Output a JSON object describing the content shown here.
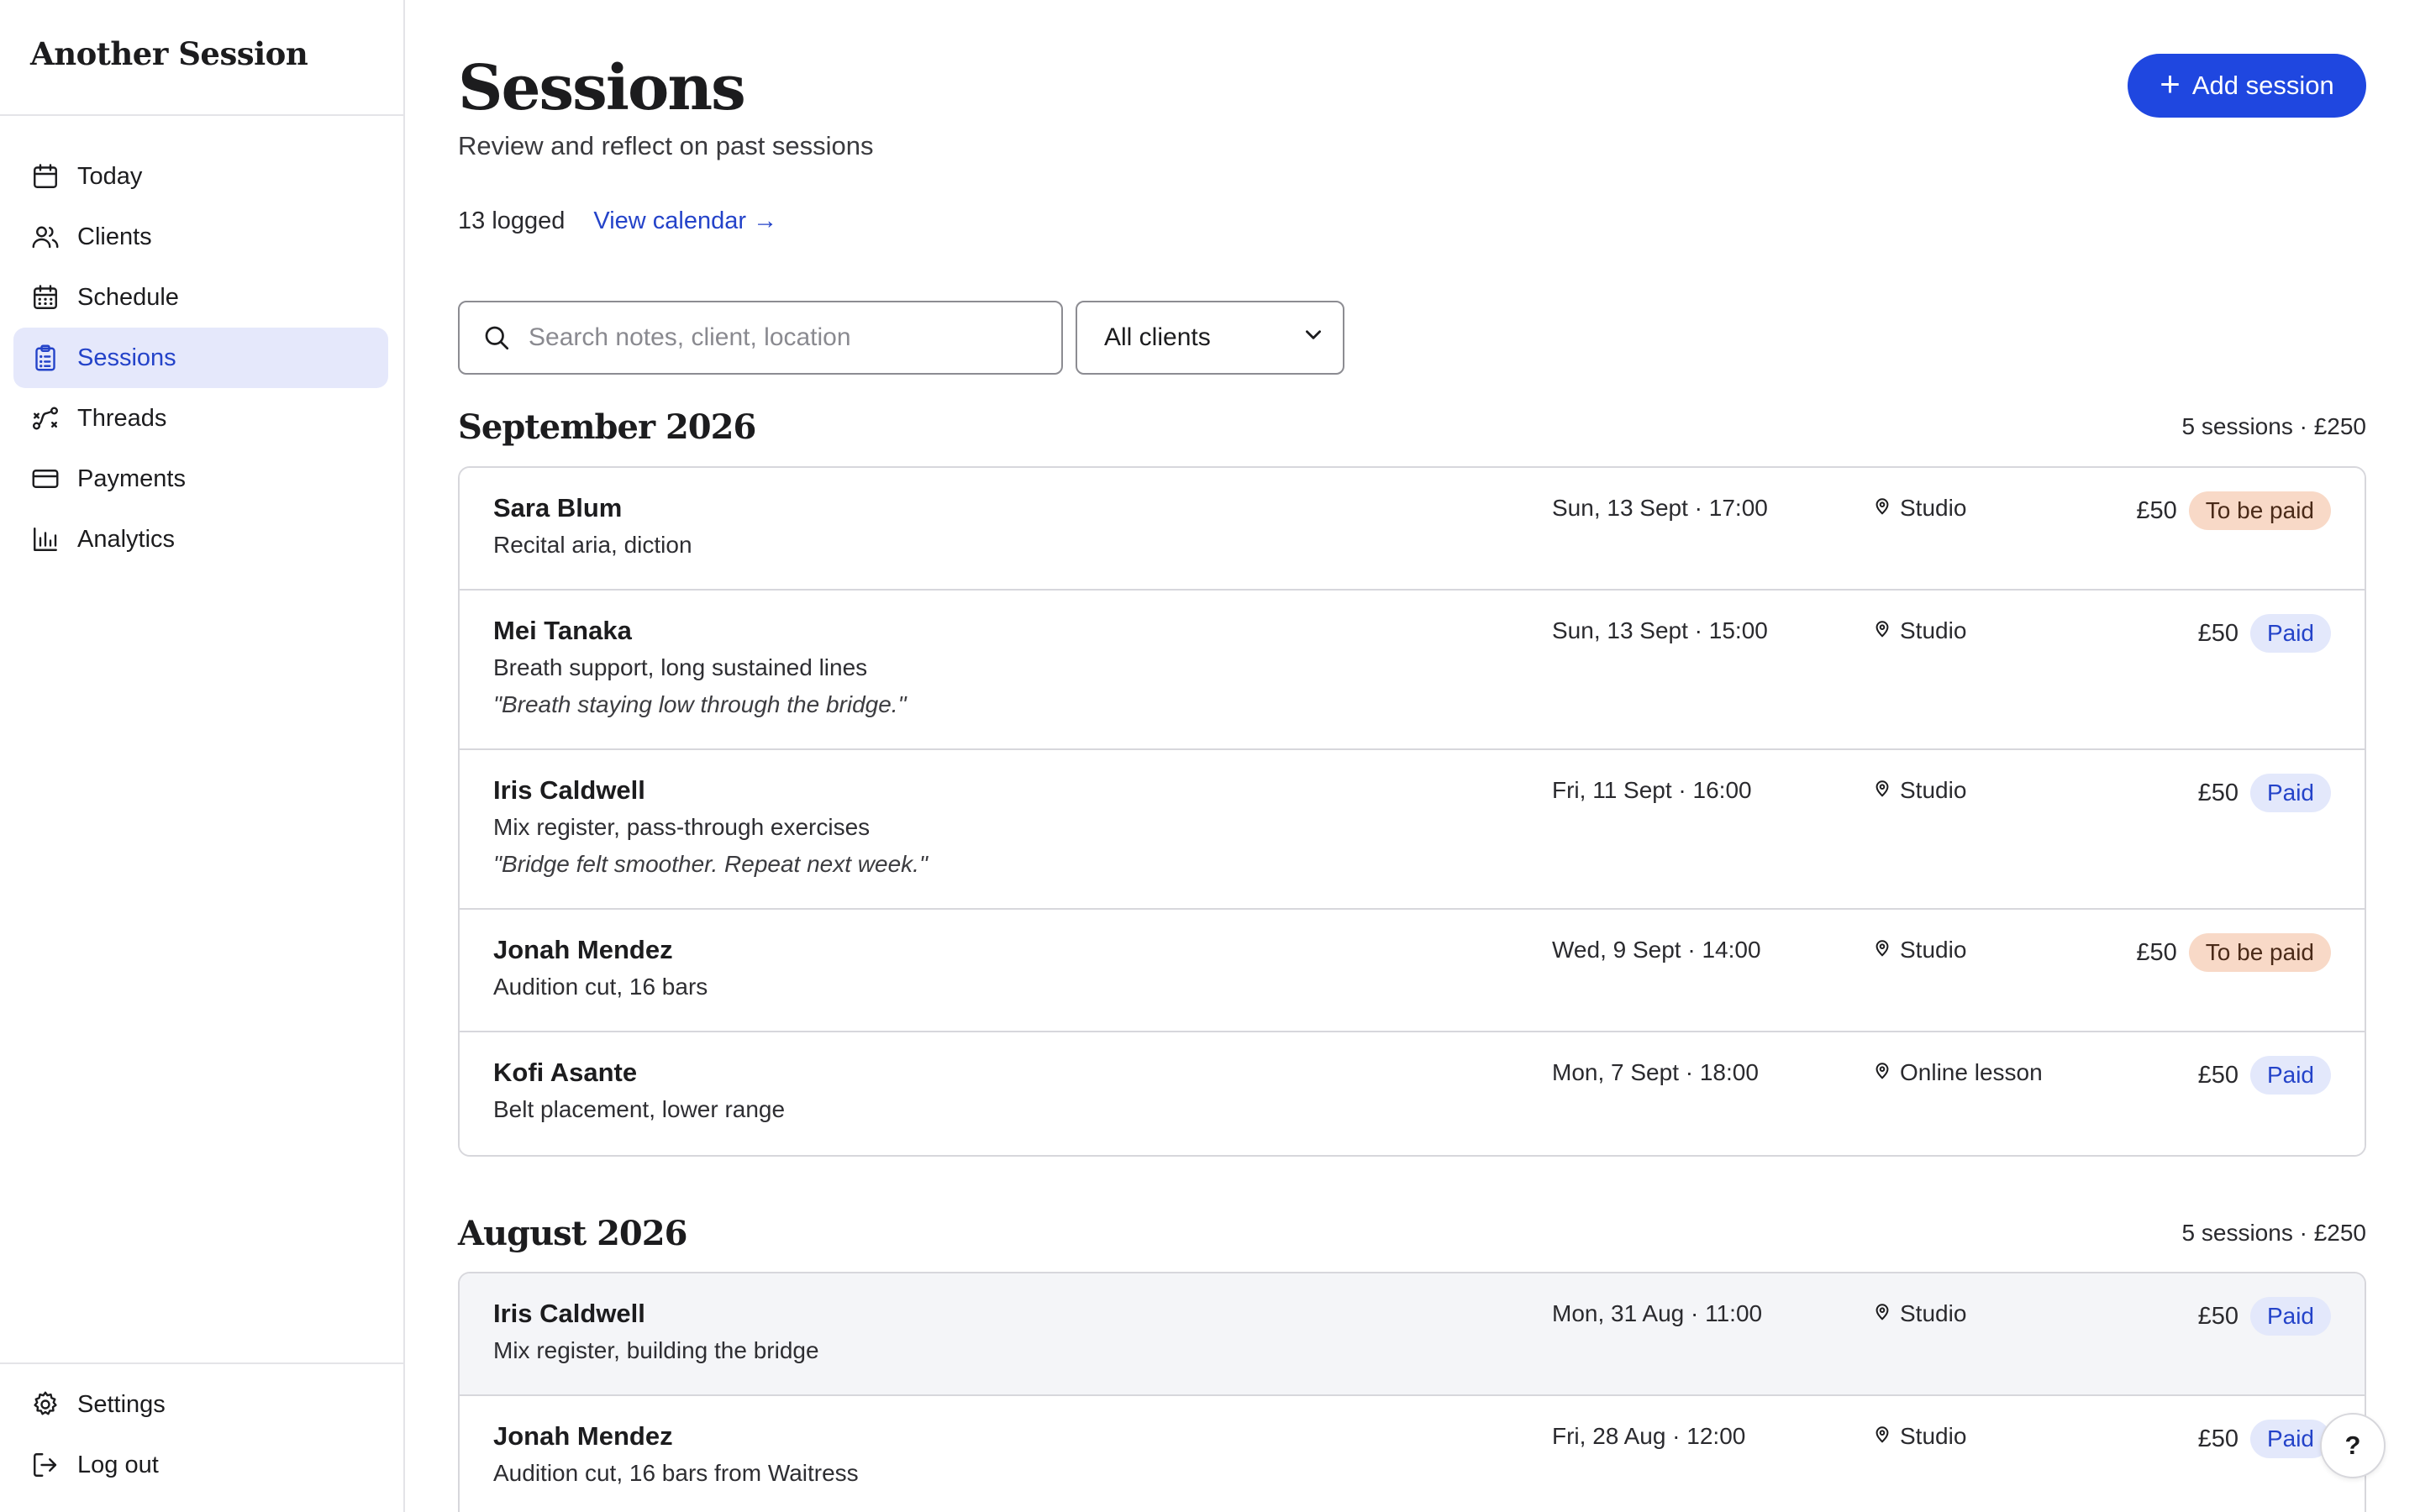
{
  "app": {
    "brand": "Another Session"
  },
  "sidebar": {
    "items": [
      {
        "label": "Today",
        "icon": "calendar-icon"
      },
      {
        "label": "Clients",
        "icon": "users-icon"
      },
      {
        "label": "Schedule",
        "icon": "calendar-grid-icon"
      },
      {
        "label": "Sessions",
        "icon": "clipboard-icon",
        "active": true
      },
      {
        "label": "Threads",
        "icon": "threads-icon"
      },
      {
        "label": "Payments",
        "icon": "credit-card-icon"
      },
      {
        "label": "Analytics",
        "icon": "bar-chart-icon"
      }
    ],
    "bottom": [
      {
        "label": "Settings",
        "icon": "gear-icon"
      },
      {
        "label": "Log out",
        "icon": "logout-icon"
      }
    ]
  },
  "header": {
    "title": "Sessions",
    "subtitle": "Review and reflect on past sessions",
    "add_label": "Add session",
    "logged_count": "13 logged",
    "calendar_link": "View calendar →"
  },
  "filters": {
    "search_placeholder": "Search notes, client, location",
    "client_filter": "All clients"
  },
  "months": [
    {
      "title": "September 2026",
      "summary": "5 sessions · £250",
      "sessions": [
        {
          "name": "Sara Blum",
          "topic": "Recital aria, diction",
          "quote": "",
          "date": "Sun, 13 Sept · 17:00",
          "location": "Studio",
          "amount": "£50",
          "status": "To be paid"
        },
        {
          "name": "Mei Tanaka",
          "topic": "Breath support, long sustained lines",
          "quote": "\"Breath staying low through the bridge.\"",
          "date": "Sun, 13 Sept · 15:00",
          "location": "Studio",
          "amount": "£50",
          "status": "Paid"
        },
        {
          "name": "Iris Caldwell",
          "topic": "Mix register, pass-through exercises",
          "quote": "\"Bridge felt smoother. Repeat next week.\"",
          "date": "Fri, 11 Sept · 16:00",
          "location": "Studio",
          "amount": "£50",
          "status": "Paid"
        },
        {
          "name": "Jonah Mendez",
          "topic": "Audition cut, 16 bars",
          "quote": "",
          "date": "Wed, 9 Sept · 14:00",
          "location": "Studio",
          "amount": "£50",
          "status": "To be paid"
        },
        {
          "name": "Kofi Asante",
          "topic": "Belt placement, lower range",
          "quote": "",
          "date": "Mon, 7 Sept · 18:00",
          "location": "Online lesson",
          "amount": "£50",
          "status": "Paid"
        }
      ]
    },
    {
      "title": "August 2026",
      "summary": "5 sessions · £250",
      "sessions": [
        {
          "name": "Iris Caldwell",
          "topic": "Mix register, building the bridge",
          "quote": "",
          "date": "Mon, 31 Aug · 11:00",
          "location": "Studio",
          "amount": "£50",
          "status": "Paid"
        },
        {
          "name": "Jonah Mendez",
          "topic": "Audition cut, 16 bars from Waitress",
          "quote": "",
          "date": "Fri, 28 Aug · 12:00",
          "location": "Studio",
          "amount": "£50",
          "status": "Paid"
        }
      ]
    }
  ],
  "help": {
    "label": "?"
  },
  "colors": {
    "accent": "#1f47e0",
    "active_nav_bg": "#e5e8fb",
    "paid_bg": "#e3e8fb",
    "unpaid_bg": "#f8d9c7"
  }
}
